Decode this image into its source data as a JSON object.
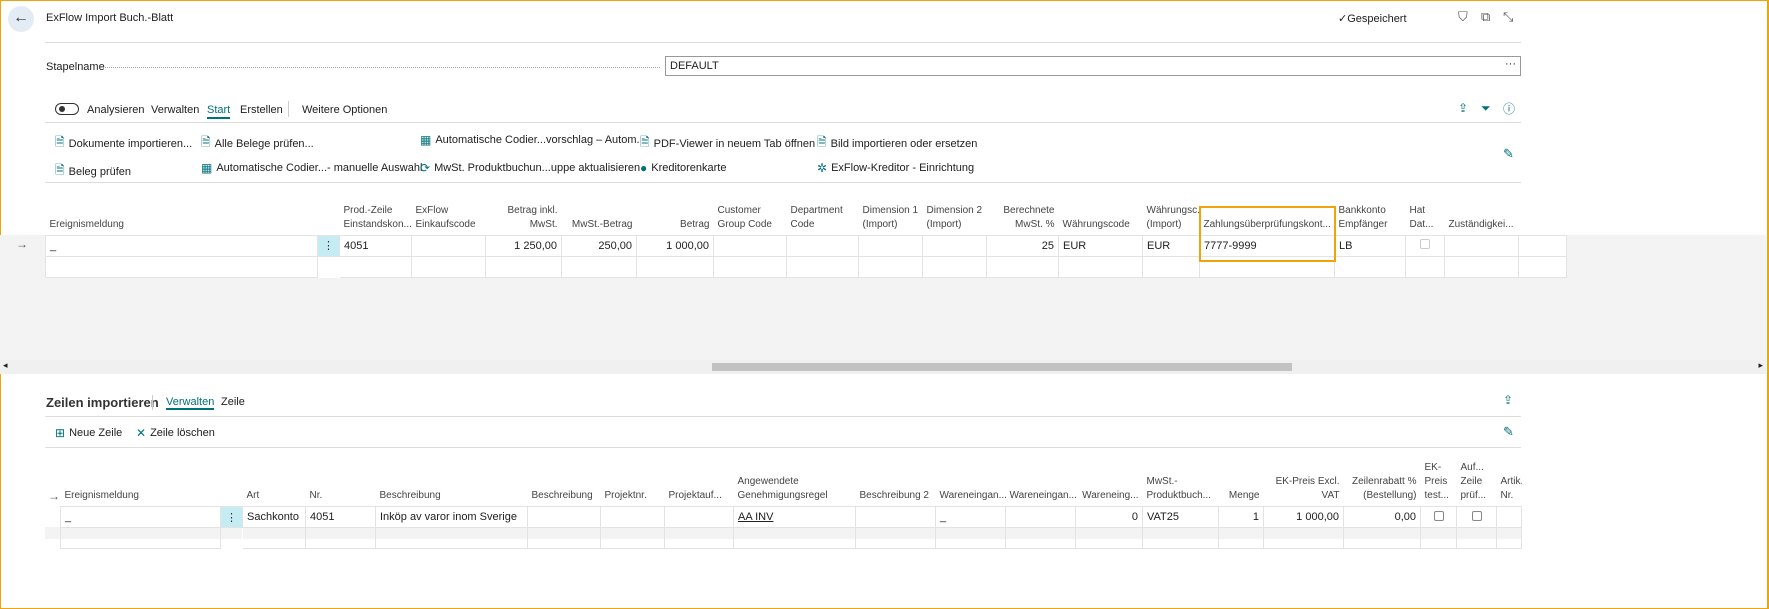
{
  "header": {
    "title": "ExFlow Import Buch.-Blatt",
    "saved": "Gespeichert"
  },
  "batch": {
    "label": "Stapelname",
    "value": "DEFAULT"
  },
  "menu": {
    "toggle_label": "Analysieren",
    "items": [
      "Verwalten",
      "Start",
      "Erstellen"
    ],
    "more": "Weitere Optionen",
    "active": "Start"
  },
  "actions": {
    "row1": [
      "Dokumente importieren...",
      "Alle Belege prüfen...",
      "Automatische Codier...vorschlag – Autom.",
      "PDF-Viewer in neuem Tab öffnen",
      "Bild importieren oder ersetzen"
    ],
    "row2": [
      "Beleg prüfen",
      "Automatische Codier...- manuelle Auswahl",
      "MwSt. Produktbuchun...uppe aktualisieren",
      "Kreditorenkarte",
      "ExFlow-Kreditor - Einrichtung"
    ]
  },
  "top_grid": {
    "columns": [
      "Ereignismeldung",
      "",
      "Prod.-Zeile Einstandskon...",
      "ExFlow Einkaufscode",
      "Betrag inkl. MwSt.",
      "MwSt.-Betrag",
      "Betrag",
      "Customer Group Code",
      "Department Code",
      "Dimension 1 (Import)",
      "Dimension 2 (Import)",
      "Berechnete MwSt. %",
      "Währungscode",
      "Währungsc... (Import)",
      "Zahlungsüberprüfungskont...",
      "Bankkonto Empfänger",
      "Hat Dat...",
      "Zuständigkei...",
      ""
    ],
    "row": [
      "_",
      "⋮",
      "4051",
      "",
      "1 250,00",
      "250,00",
      "1 000,00",
      "",
      "",
      "",
      "",
      "25",
      "EUR",
      "EUR",
      "7777-9999",
      "LB",
      "",
      "",
      ""
    ]
  },
  "lines": {
    "title": "Zeilen importieren",
    "tabs": [
      "Verwalten",
      "Zeile"
    ],
    "actions": [
      "Neue Zeile",
      "Zeile löschen"
    ]
  },
  "bottom_grid": {
    "columns": [
      "Ereignismeldung",
      "",
      "Art",
      "Nr.",
      "Beschreibung",
      "Beschreibung",
      "Projektnr.",
      "Projektauf...",
      "Angewendete Genehmigungsregel",
      "Beschreibung 2",
      "Wareneingan...",
      "Wareneingan...",
      "Wareneing...",
      "MwSt.-Produktbuch...",
      "Menge",
      "EK-Preis Excl. VAT",
      "Zeilenrabatt % (Bestellung)",
      "EK-Preis test...",
      "Auf... Zeile prüf...",
      "Artik. Nr."
    ],
    "row": [
      "_",
      "⋮",
      "Sachkonto",
      "4051",
      "Inköp av varor inom Sverige",
      "",
      "",
      "",
      "AA INV",
      "",
      "_",
      "",
      "0",
      "VAT25",
      "1",
      "1 000,00",
      "0,00",
      "",
      "",
      ""
    ]
  }
}
